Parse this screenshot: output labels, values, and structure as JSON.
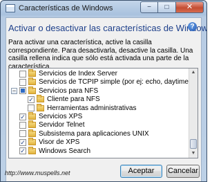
{
  "window": {
    "title": "Características de Windows",
    "buttons": {
      "minimize": "−",
      "maximize": "□",
      "close": "✕"
    }
  },
  "heading": "Activar o desactivar las características de Windows",
  "help_icon": "?",
  "description": "Para activar una característica, active la casilla correspondiente. Para desactivarla, desactive la casilla. Una casilla rellena indica que sólo está activada una parte de la característica.",
  "features": [
    {
      "label": "Servicios de Index Server",
      "check": "unchecked",
      "expander": "none",
      "level": 0
    },
    {
      "label": "Servicios de TCPIP simple (por ej: echo, daytime etc)",
      "check": "unchecked",
      "expander": "none",
      "level": 0
    },
    {
      "label": "Servicios para NFS",
      "check": "partial",
      "expander": "collapse",
      "level": 0
    },
    {
      "label": "Cliente para NFS",
      "check": "checked",
      "expander": "none",
      "level": 1
    },
    {
      "label": "Herramientas administrativas",
      "check": "unchecked",
      "expander": "none",
      "level": 1
    },
    {
      "label": "Servicios XPS",
      "check": "checked",
      "expander": "none",
      "level": 0
    },
    {
      "label": "Servidor Telnet",
      "check": "unchecked",
      "expander": "none",
      "level": 0
    },
    {
      "label": "Subsistema para aplicaciones UNIX",
      "check": "unchecked",
      "expander": "none",
      "level": 0
    },
    {
      "label": "Visor de XPS",
      "check": "checked",
      "expander": "none",
      "level": 0
    },
    {
      "label": "Windows Search",
      "check": "checked",
      "expander": "none",
      "level": 0
    }
  ],
  "buttons": {
    "accept": "Aceptar",
    "cancel": "Cancelar"
  },
  "watermark": "http://www.muspells.net",
  "colors": {
    "heading": "#1d3f8a",
    "partial_fill": "#2e6bc4"
  }
}
